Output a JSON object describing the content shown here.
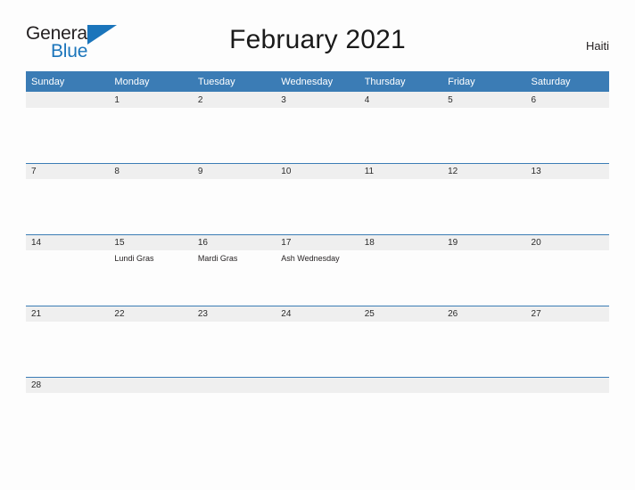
{
  "brand": {
    "name_part1": "General",
    "name_part2": "Blue",
    "accent_color": "#1b75bb"
  },
  "header": {
    "title": "February 2021",
    "country": "Haiti"
  },
  "theme": {
    "header_blue": "#3b7cb5",
    "date_band_gray": "#efefef",
    "page_background": "#fdfdfd",
    "text_color": "#231f20"
  },
  "calendar": {
    "weekday_headers": [
      "Sunday",
      "Monday",
      "Tuesday",
      "Wednesday",
      "Thursday",
      "Friday",
      "Saturday"
    ],
    "weeks": [
      [
        {
          "day": "",
          "event": ""
        },
        {
          "day": "1",
          "event": ""
        },
        {
          "day": "2",
          "event": ""
        },
        {
          "day": "3",
          "event": ""
        },
        {
          "day": "4",
          "event": ""
        },
        {
          "day": "5",
          "event": ""
        },
        {
          "day": "6",
          "event": ""
        }
      ],
      [
        {
          "day": "7",
          "event": ""
        },
        {
          "day": "8",
          "event": ""
        },
        {
          "day": "9",
          "event": ""
        },
        {
          "day": "10",
          "event": ""
        },
        {
          "day": "11",
          "event": ""
        },
        {
          "day": "12",
          "event": ""
        },
        {
          "day": "13",
          "event": ""
        }
      ],
      [
        {
          "day": "14",
          "event": ""
        },
        {
          "day": "15",
          "event": "Lundi Gras"
        },
        {
          "day": "16",
          "event": "Mardi Gras"
        },
        {
          "day": "17",
          "event": "Ash Wednesday"
        },
        {
          "day": "18",
          "event": ""
        },
        {
          "day": "19",
          "event": ""
        },
        {
          "day": "20",
          "event": ""
        }
      ],
      [
        {
          "day": "21",
          "event": ""
        },
        {
          "day": "22",
          "event": ""
        },
        {
          "day": "23",
          "event": ""
        },
        {
          "day": "24",
          "event": ""
        },
        {
          "day": "25",
          "event": ""
        },
        {
          "day": "26",
          "event": ""
        },
        {
          "day": "27",
          "event": ""
        }
      ],
      [
        {
          "day": "28",
          "event": ""
        },
        {
          "day": "",
          "event": ""
        },
        {
          "day": "",
          "event": ""
        },
        {
          "day": "",
          "event": ""
        },
        {
          "day": "",
          "event": ""
        },
        {
          "day": "",
          "event": ""
        },
        {
          "day": "",
          "event": ""
        }
      ]
    ]
  }
}
